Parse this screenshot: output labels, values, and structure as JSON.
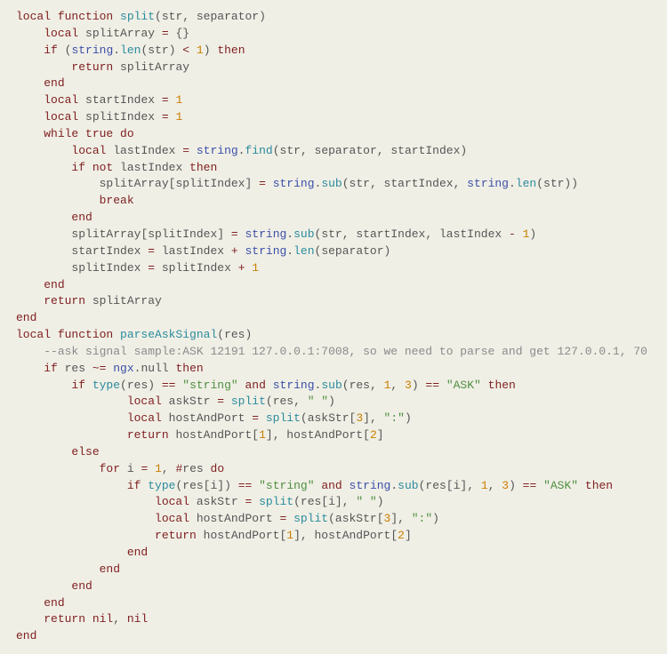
{
  "lines": [
    {
      "indent": 0,
      "tokens": [
        {
          "t": "local ",
          "c": "kw"
        },
        {
          "t": "function ",
          "c": "kw"
        },
        {
          "t": "split",
          "c": "fn"
        },
        {
          "t": "(",
          "c": "punc"
        },
        {
          "t": "str",
          "c": "id"
        },
        {
          "t": ", ",
          "c": "punc"
        },
        {
          "t": "separator",
          "c": "id"
        },
        {
          "t": ")",
          "c": "punc"
        }
      ]
    },
    {
      "indent": 1,
      "tokens": [
        {
          "t": "local ",
          "c": "kw"
        },
        {
          "t": "splitArray ",
          "c": "id"
        },
        {
          "t": "= ",
          "c": "op"
        },
        {
          "t": "{}",
          "c": "punc"
        }
      ]
    },
    {
      "indent": 1,
      "tokens": [
        {
          "t": "if ",
          "c": "kw"
        },
        {
          "t": "(",
          "c": "punc"
        },
        {
          "t": "string",
          "c": "ns"
        },
        {
          "t": ".",
          "c": "punc"
        },
        {
          "t": "len",
          "c": "fn"
        },
        {
          "t": "(",
          "c": "punc"
        },
        {
          "t": "str",
          "c": "id"
        },
        {
          "t": ") ",
          "c": "punc"
        },
        {
          "t": "< ",
          "c": "op"
        },
        {
          "t": "1",
          "c": "num"
        },
        {
          "t": ") ",
          "c": "punc"
        },
        {
          "t": "then",
          "c": "kw"
        }
      ]
    },
    {
      "indent": 2,
      "tokens": [
        {
          "t": "return ",
          "c": "kw"
        },
        {
          "t": "splitArray",
          "c": "id"
        }
      ]
    },
    {
      "indent": 1,
      "tokens": [
        {
          "t": "end",
          "c": "kw"
        }
      ]
    },
    {
      "indent": 1,
      "tokens": [
        {
          "t": "local ",
          "c": "kw"
        },
        {
          "t": "startIndex ",
          "c": "id"
        },
        {
          "t": "= ",
          "c": "op"
        },
        {
          "t": "1",
          "c": "num"
        }
      ]
    },
    {
      "indent": 1,
      "tokens": [
        {
          "t": "local ",
          "c": "kw"
        },
        {
          "t": "splitIndex ",
          "c": "id"
        },
        {
          "t": "= ",
          "c": "op"
        },
        {
          "t": "1",
          "c": "num"
        }
      ]
    },
    {
      "indent": 1,
      "tokens": [
        {
          "t": "while ",
          "c": "kw"
        },
        {
          "t": "true ",
          "c": "kw"
        },
        {
          "t": "do",
          "c": "kw"
        }
      ]
    },
    {
      "indent": 2,
      "tokens": [
        {
          "t": "local ",
          "c": "kw"
        },
        {
          "t": "lastIndex ",
          "c": "id"
        },
        {
          "t": "= ",
          "c": "op"
        },
        {
          "t": "string",
          "c": "ns"
        },
        {
          "t": ".",
          "c": "punc"
        },
        {
          "t": "find",
          "c": "fn"
        },
        {
          "t": "(",
          "c": "punc"
        },
        {
          "t": "str",
          "c": "id"
        },
        {
          "t": ", ",
          "c": "punc"
        },
        {
          "t": "separator",
          "c": "id"
        },
        {
          "t": ", ",
          "c": "punc"
        },
        {
          "t": "startIndex",
          "c": "id"
        },
        {
          "t": ")",
          "c": "punc"
        }
      ]
    },
    {
      "indent": 2,
      "tokens": [
        {
          "t": "if ",
          "c": "kw"
        },
        {
          "t": "not ",
          "c": "kw"
        },
        {
          "t": "lastIndex ",
          "c": "id"
        },
        {
          "t": "then",
          "c": "kw"
        }
      ]
    },
    {
      "indent": 3,
      "tokens": [
        {
          "t": "splitArray",
          "c": "id"
        },
        {
          "t": "[",
          "c": "punc"
        },
        {
          "t": "splitIndex",
          "c": "id"
        },
        {
          "t": "] ",
          "c": "punc"
        },
        {
          "t": "= ",
          "c": "op"
        },
        {
          "t": "string",
          "c": "ns"
        },
        {
          "t": ".",
          "c": "punc"
        },
        {
          "t": "sub",
          "c": "fn"
        },
        {
          "t": "(",
          "c": "punc"
        },
        {
          "t": "str",
          "c": "id"
        },
        {
          "t": ", ",
          "c": "punc"
        },
        {
          "t": "startIndex",
          "c": "id"
        },
        {
          "t": ", ",
          "c": "punc"
        },
        {
          "t": "string",
          "c": "ns"
        },
        {
          "t": ".",
          "c": "punc"
        },
        {
          "t": "len",
          "c": "fn"
        },
        {
          "t": "(",
          "c": "punc"
        },
        {
          "t": "str",
          "c": "id"
        },
        {
          "t": "))",
          "c": "punc"
        }
      ]
    },
    {
      "indent": 3,
      "tokens": [
        {
          "t": "break",
          "c": "kw"
        }
      ]
    },
    {
      "indent": 2,
      "tokens": [
        {
          "t": "end",
          "c": "kw"
        }
      ]
    },
    {
      "indent": 2,
      "tokens": [
        {
          "t": "splitArray",
          "c": "id"
        },
        {
          "t": "[",
          "c": "punc"
        },
        {
          "t": "splitIndex",
          "c": "id"
        },
        {
          "t": "] ",
          "c": "punc"
        },
        {
          "t": "= ",
          "c": "op"
        },
        {
          "t": "string",
          "c": "ns"
        },
        {
          "t": ".",
          "c": "punc"
        },
        {
          "t": "sub",
          "c": "fn"
        },
        {
          "t": "(",
          "c": "punc"
        },
        {
          "t": "str",
          "c": "id"
        },
        {
          "t": ", ",
          "c": "punc"
        },
        {
          "t": "startIndex",
          "c": "id"
        },
        {
          "t": ", ",
          "c": "punc"
        },
        {
          "t": "lastIndex ",
          "c": "id"
        },
        {
          "t": "- ",
          "c": "op"
        },
        {
          "t": "1",
          "c": "num"
        },
        {
          "t": ")",
          "c": "punc"
        }
      ]
    },
    {
      "indent": 2,
      "tokens": [
        {
          "t": "startIndex ",
          "c": "id"
        },
        {
          "t": "= ",
          "c": "op"
        },
        {
          "t": "lastIndex ",
          "c": "id"
        },
        {
          "t": "+ ",
          "c": "op"
        },
        {
          "t": "string",
          "c": "ns"
        },
        {
          "t": ".",
          "c": "punc"
        },
        {
          "t": "len",
          "c": "fn"
        },
        {
          "t": "(",
          "c": "punc"
        },
        {
          "t": "separator",
          "c": "id"
        },
        {
          "t": ")",
          "c": "punc"
        }
      ]
    },
    {
      "indent": 2,
      "tokens": [
        {
          "t": "splitIndex ",
          "c": "id"
        },
        {
          "t": "= ",
          "c": "op"
        },
        {
          "t": "splitIndex ",
          "c": "id"
        },
        {
          "t": "+ ",
          "c": "op"
        },
        {
          "t": "1",
          "c": "num"
        }
      ]
    },
    {
      "indent": 1,
      "tokens": [
        {
          "t": "end",
          "c": "kw"
        }
      ]
    },
    {
      "indent": 1,
      "tokens": [
        {
          "t": "return ",
          "c": "kw"
        },
        {
          "t": "splitArray",
          "c": "id"
        }
      ]
    },
    {
      "indent": 0,
      "tokens": [
        {
          "t": "end",
          "c": "kw"
        }
      ]
    },
    {
      "indent": 0,
      "tokens": [
        {
          "t": "",
          "c": "id"
        }
      ]
    },
    {
      "indent": 0,
      "tokens": [
        {
          "t": "local ",
          "c": "kw"
        },
        {
          "t": "function ",
          "c": "kw"
        },
        {
          "t": "parseAskSignal",
          "c": "fn"
        },
        {
          "t": "(",
          "c": "punc"
        },
        {
          "t": "res",
          "c": "id"
        },
        {
          "t": ")",
          "c": "punc"
        }
      ]
    },
    {
      "indent": 1,
      "tokens": [
        {
          "t": "--ask signal sample:ASK 12191 127.0.0.1:7008, so we need to parse and get 127.0.0.1, 70",
          "c": "cmt"
        }
      ]
    },
    {
      "indent": 1,
      "tokens": [
        {
          "t": "if ",
          "c": "kw"
        },
        {
          "t": "res ",
          "c": "id"
        },
        {
          "t": "~= ",
          "c": "op"
        },
        {
          "t": "ngx",
          "c": "ns"
        },
        {
          "t": ".",
          "c": "punc"
        },
        {
          "t": "null ",
          "c": "id"
        },
        {
          "t": "then",
          "c": "kw"
        }
      ]
    },
    {
      "indent": 2,
      "tokens": [
        {
          "t": "if ",
          "c": "kw"
        },
        {
          "t": "type",
          "c": "fn"
        },
        {
          "t": "(",
          "c": "punc"
        },
        {
          "t": "res",
          "c": "id"
        },
        {
          "t": ") ",
          "c": "punc"
        },
        {
          "t": "== ",
          "c": "op"
        },
        {
          "t": "\"string\" ",
          "c": "str"
        },
        {
          "t": "and ",
          "c": "kw"
        },
        {
          "t": "string",
          "c": "ns"
        },
        {
          "t": ".",
          "c": "punc"
        },
        {
          "t": "sub",
          "c": "fn"
        },
        {
          "t": "(",
          "c": "punc"
        },
        {
          "t": "res",
          "c": "id"
        },
        {
          "t": ", ",
          "c": "punc"
        },
        {
          "t": "1",
          "c": "num"
        },
        {
          "t": ", ",
          "c": "punc"
        },
        {
          "t": "3",
          "c": "num"
        },
        {
          "t": ") ",
          "c": "punc"
        },
        {
          "t": "== ",
          "c": "op"
        },
        {
          "t": "\"ASK\" ",
          "c": "str"
        },
        {
          "t": "then",
          "c": "kw"
        }
      ]
    },
    {
      "indent": 4,
      "tokens": [
        {
          "t": "local ",
          "c": "kw"
        },
        {
          "t": "askStr ",
          "c": "id"
        },
        {
          "t": "= ",
          "c": "op"
        },
        {
          "t": "split",
          "c": "fn"
        },
        {
          "t": "(",
          "c": "punc"
        },
        {
          "t": "res",
          "c": "id"
        },
        {
          "t": ", ",
          "c": "punc"
        },
        {
          "t": "\" \"",
          "c": "str"
        },
        {
          "t": ")",
          "c": "punc"
        }
      ]
    },
    {
      "indent": 4,
      "tokens": [
        {
          "t": "local ",
          "c": "kw"
        },
        {
          "t": "hostAndPort ",
          "c": "id"
        },
        {
          "t": "= ",
          "c": "op"
        },
        {
          "t": "split",
          "c": "fn"
        },
        {
          "t": "(",
          "c": "punc"
        },
        {
          "t": "askStr",
          "c": "id"
        },
        {
          "t": "[",
          "c": "punc"
        },
        {
          "t": "3",
          "c": "num"
        },
        {
          "t": "], ",
          "c": "punc"
        },
        {
          "t": "\":\"",
          "c": "str"
        },
        {
          "t": ")",
          "c": "punc"
        }
      ]
    },
    {
      "indent": 4,
      "tokens": [
        {
          "t": "return ",
          "c": "kw"
        },
        {
          "t": "hostAndPort",
          "c": "id"
        },
        {
          "t": "[",
          "c": "punc"
        },
        {
          "t": "1",
          "c": "num"
        },
        {
          "t": "], ",
          "c": "punc"
        },
        {
          "t": "hostAndPort",
          "c": "id"
        },
        {
          "t": "[",
          "c": "punc"
        },
        {
          "t": "2",
          "c": "num"
        },
        {
          "t": "]",
          "c": "punc"
        }
      ]
    },
    {
      "indent": 2,
      "tokens": [
        {
          "t": "else",
          "c": "kw"
        }
      ]
    },
    {
      "indent": 3,
      "tokens": [
        {
          "t": "for ",
          "c": "kw"
        },
        {
          "t": "i ",
          "c": "id"
        },
        {
          "t": "= ",
          "c": "op"
        },
        {
          "t": "1",
          "c": "num"
        },
        {
          "t": ", ",
          "c": "punc"
        },
        {
          "t": "#",
          "c": "op"
        },
        {
          "t": "res ",
          "c": "id"
        },
        {
          "t": "do",
          "c": "kw"
        }
      ]
    },
    {
      "indent": 4,
      "tokens": [
        {
          "t": "if ",
          "c": "kw"
        },
        {
          "t": "type",
          "c": "fn"
        },
        {
          "t": "(",
          "c": "punc"
        },
        {
          "t": "res",
          "c": "id"
        },
        {
          "t": "[",
          "c": "punc"
        },
        {
          "t": "i",
          "c": "id"
        },
        {
          "t": "]) ",
          "c": "punc"
        },
        {
          "t": "== ",
          "c": "op"
        },
        {
          "t": "\"string\" ",
          "c": "str"
        },
        {
          "t": "and ",
          "c": "kw"
        },
        {
          "t": "string",
          "c": "ns"
        },
        {
          "t": ".",
          "c": "punc"
        },
        {
          "t": "sub",
          "c": "fn"
        },
        {
          "t": "(",
          "c": "punc"
        },
        {
          "t": "res",
          "c": "id"
        },
        {
          "t": "[",
          "c": "punc"
        },
        {
          "t": "i",
          "c": "id"
        },
        {
          "t": "], ",
          "c": "punc"
        },
        {
          "t": "1",
          "c": "num"
        },
        {
          "t": ", ",
          "c": "punc"
        },
        {
          "t": "3",
          "c": "num"
        },
        {
          "t": ") ",
          "c": "punc"
        },
        {
          "t": "== ",
          "c": "op"
        },
        {
          "t": "\"ASK\" ",
          "c": "str"
        },
        {
          "t": "then",
          "c": "kw"
        }
      ]
    },
    {
      "indent": 5,
      "tokens": [
        {
          "t": "local ",
          "c": "kw"
        },
        {
          "t": "askStr ",
          "c": "id"
        },
        {
          "t": "= ",
          "c": "op"
        },
        {
          "t": "split",
          "c": "fn"
        },
        {
          "t": "(",
          "c": "punc"
        },
        {
          "t": "res",
          "c": "id"
        },
        {
          "t": "[",
          "c": "punc"
        },
        {
          "t": "i",
          "c": "id"
        },
        {
          "t": "], ",
          "c": "punc"
        },
        {
          "t": "\" \"",
          "c": "str"
        },
        {
          "t": ")",
          "c": "punc"
        }
      ]
    },
    {
      "indent": 5,
      "tokens": [
        {
          "t": "local ",
          "c": "kw"
        },
        {
          "t": "hostAndPort ",
          "c": "id"
        },
        {
          "t": "= ",
          "c": "op"
        },
        {
          "t": "split",
          "c": "fn"
        },
        {
          "t": "(",
          "c": "punc"
        },
        {
          "t": "askStr",
          "c": "id"
        },
        {
          "t": "[",
          "c": "punc"
        },
        {
          "t": "3",
          "c": "num"
        },
        {
          "t": "], ",
          "c": "punc"
        },
        {
          "t": "\":\"",
          "c": "str"
        },
        {
          "t": ")",
          "c": "punc"
        }
      ]
    },
    {
      "indent": 5,
      "tokens": [
        {
          "t": "return ",
          "c": "kw"
        },
        {
          "t": "hostAndPort",
          "c": "id"
        },
        {
          "t": "[",
          "c": "punc"
        },
        {
          "t": "1",
          "c": "num"
        },
        {
          "t": "], ",
          "c": "punc"
        },
        {
          "t": "hostAndPort",
          "c": "id"
        },
        {
          "t": "[",
          "c": "punc"
        },
        {
          "t": "2",
          "c": "num"
        },
        {
          "t": "]",
          "c": "punc"
        }
      ]
    },
    {
      "indent": 4,
      "tokens": [
        {
          "t": "end",
          "c": "kw"
        }
      ]
    },
    {
      "indent": 3,
      "tokens": [
        {
          "t": "end",
          "c": "kw"
        }
      ]
    },
    {
      "indent": 2,
      "tokens": [
        {
          "t": "end",
          "c": "kw"
        }
      ]
    },
    {
      "indent": 1,
      "tokens": [
        {
          "t": "end",
          "c": "kw"
        }
      ]
    },
    {
      "indent": 1,
      "tokens": [
        {
          "t": "return ",
          "c": "kw"
        },
        {
          "t": "nil",
          "c": "kw"
        },
        {
          "t": ", ",
          "c": "punc"
        },
        {
          "t": "nil",
          "c": "kw"
        }
      ]
    },
    {
      "indent": 0,
      "tokens": [
        {
          "t": "end",
          "c": "kw"
        }
      ]
    }
  ]
}
